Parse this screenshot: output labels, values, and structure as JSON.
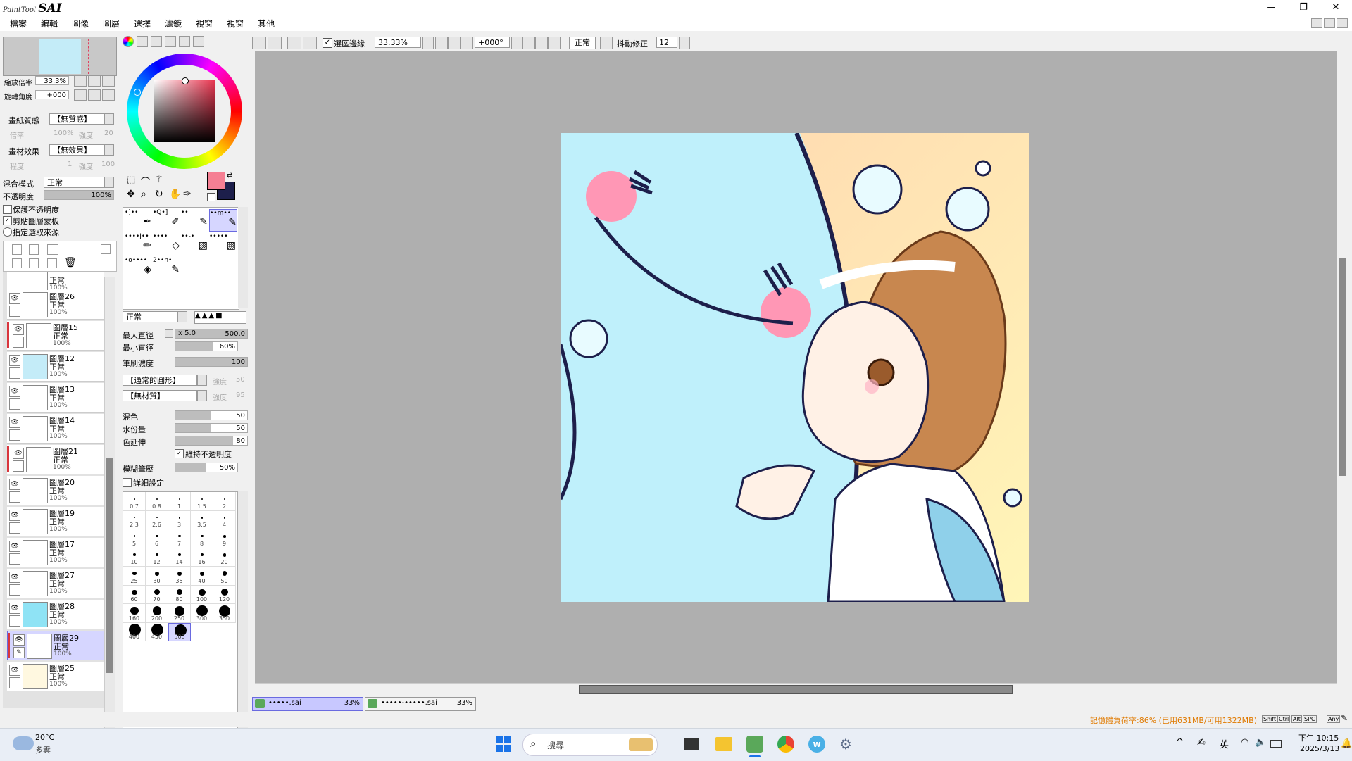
{
  "app": {
    "logo_small": "PaintTool",
    "logo_big": "SAI"
  },
  "window_controls": {
    "minimize": "—",
    "restore": "❐",
    "close": "✕"
  },
  "menu": [
    "檔案",
    "編輯",
    "圖像",
    "圖層",
    "選擇",
    "濾鏡",
    "視窗",
    "視窗",
    "其他"
  ],
  "toolbar": {
    "selection_edge_label": "選區邊緣",
    "zoom": "33.33%",
    "rotation": "+000°",
    "blend": "正常",
    "stabilizer_label": "抖動修正",
    "stabilizer_value": "12"
  },
  "navigator": {
    "zoom_label": "縮放倍率",
    "zoom_value": "33.3%",
    "rotate_label": "旋轉角度",
    "rotate_value": "+000"
  },
  "paper": {
    "paper_texture_label": "畫紙質感",
    "paper_texture_value": "【無質感】",
    "scale_label": "倍率",
    "scale_value": "100%",
    "strength_label": "強度",
    "strength_value": "20",
    "effect_label": "畫材效果",
    "effect_value": "【無效果】",
    "degree_label": "程度",
    "degree_value": "1",
    "strength2_label": "強度",
    "strength2_value": "100"
  },
  "layer_props": {
    "blend_label": "混合模式",
    "blend_value": "正常",
    "opacity_label": "不透明度",
    "opacity_value": "100%",
    "protect_opacity": "保護不透明度",
    "clip_group": "剪貼圖層蒙板",
    "selection_source": "指定選取來源"
  },
  "layers": [
    {
      "name": "",
      "mode": "正常",
      "opacity": "100%",
      "partial": true
    },
    {
      "name": "圖層26",
      "mode": "正常",
      "opacity": "100%",
      "thumb": "#ffffff"
    },
    {
      "name": "圖層15",
      "mode": "正常",
      "opacity": "100%",
      "thumb": "#ffffff",
      "clip": true
    },
    {
      "name": "圖層12",
      "mode": "正常",
      "opacity": "100%",
      "thumb": "#c4ecf8"
    },
    {
      "name": "圖層13",
      "mode": "正常",
      "opacity": "100%",
      "thumb": "#ffffff"
    },
    {
      "name": "圖層14",
      "mode": "正常",
      "opacity": "100%",
      "thumb": "#ffffff"
    },
    {
      "name": "圖層21",
      "mode": "正常",
      "opacity": "100%",
      "thumb": "#ffffff",
      "clip": true
    },
    {
      "name": "圖層20",
      "mode": "正常",
      "opacity": "100%",
      "thumb": "#ffffff"
    },
    {
      "name": "圖層19",
      "mode": "正常",
      "opacity": "100%",
      "thumb": "#ffffff"
    },
    {
      "name": "圖層17",
      "mode": "正常",
      "opacity": "100%",
      "thumb": "#ffffff"
    },
    {
      "name": "圖層27",
      "mode": "正常",
      "opacity": "100%",
      "thumb": "#ffffff"
    },
    {
      "name": "圖層28",
      "mode": "正常",
      "opacity": "100%",
      "thumb": "#8fe3f5"
    },
    {
      "name": "圖層29",
      "mode": "正常",
      "opacity": "100%",
      "thumb": "#ffffff",
      "clip": true,
      "selected": true
    },
    {
      "name": "圖層25",
      "mode": "正常",
      "opacity": "100%",
      "thumb": "#fff8e0"
    }
  ],
  "colors": {
    "primary": "#f57f93",
    "secondary": "#1d1f4b",
    "accent_select": "#6a6ae0"
  },
  "brush": {
    "mode": "正常",
    "max_size_label": "最大直徑",
    "max_size_mult": "x 5.0",
    "max_size_value": "500.0",
    "max_size_fill": 1.0,
    "min_size_label": "最小直徑",
    "min_size_value": "60%",
    "min_size_fill": 0.6,
    "density_label": "筆刷濃度",
    "density_value": "100",
    "density_fill": 1.0,
    "shape_value": "【通常的圓形】",
    "shape_strength_label": "強度",
    "shape_strength_value": "50",
    "texture_value": "【無材質】",
    "texture_strength_label": "強度",
    "texture_strength_value": "95",
    "blend_label": "混色",
    "blend_value": "50",
    "blend_fill": 0.5,
    "water_label": "水份量",
    "water_value": "50",
    "water_fill": 0.5,
    "persist_label": "色延伸",
    "persist_value": "80",
    "persist_fill": 0.8,
    "keep_opacity": "維持不透明度",
    "blur_label": "模糊筆壓",
    "blur_value": "50%",
    "blur_fill": 0.5,
    "detail": "詳細設定"
  },
  "brush_sizes": [
    "0.7",
    "0.8",
    "1",
    "1.5",
    "2",
    "2.3",
    "2.6",
    "3",
    "3.5",
    "4",
    "5",
    "6",
    "7",
    "8",
    "9",
    "10",
    "12",
    "14",
    "16",
    "20",
    "25",
    "30",
    "35",
    "40",
    "50",
    "60",
    "70",
    "80",
    "100",
    "120",
    "160",
    "200",
    "250",
    "300",
    "350",
    "400",
    "450",
    "500"
  ],
  "tool_rows": [
    {
      "labels": [
        "•]••",
        "•Q•]",
        "••",
        "••m••"
      ]
    },
    {
      "labels": [
        "••••J••",
        "••••",
        "••-•",
        "•••••"
      ]
    },
    {
      "labels": [
        "•o••••",
        "2••n•"
      ]
    }
  ],
  "doc_tabs": [
    {
      "name": "•••••.sai",
      "zoom": "33%"
    },
    {
      "name": "•••••-•••••.sai",
      "zoom": "33%"
    }
  ],
  "status": {
    "memory": "記憶體負荷率:86% (已用631MB/可用1322MB)",
    "keys": [
      "Shift",
      "Ctrl",
      "Alt",
      "SPC",
      "Any"
    ]
  },
  "taskbar": {
    "weather_temp": "20°C",
    "weather_desc": "多雲",
    "search": "搜尋",
    "ime": "英",
    "time": "下午 10:15",
    "date": "2025/3/13"
  }
}
